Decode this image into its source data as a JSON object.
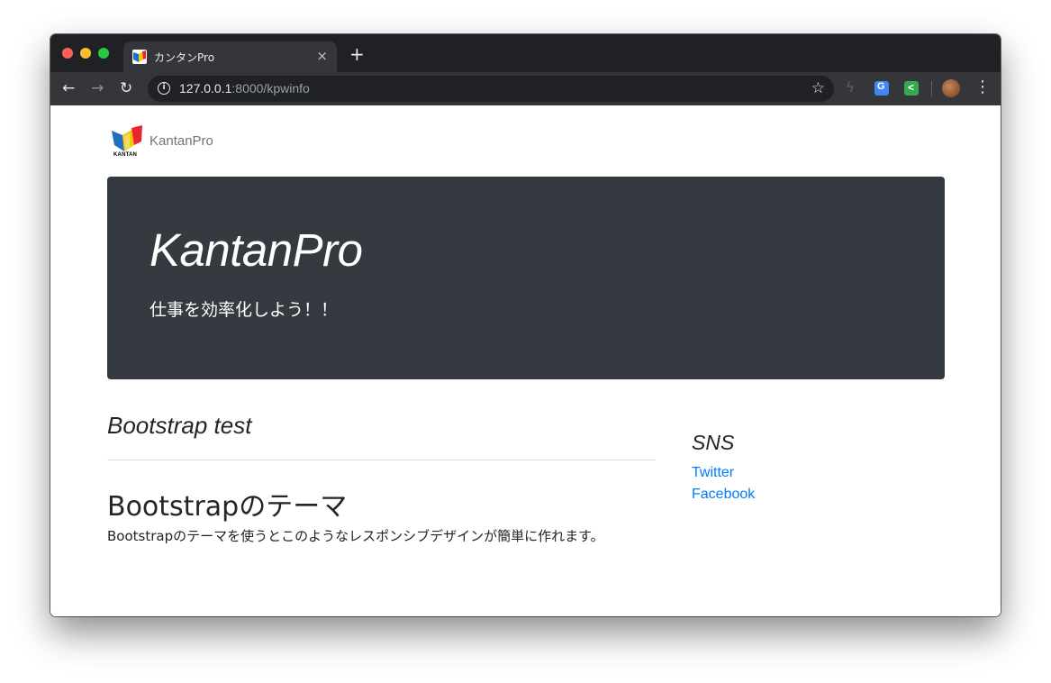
{
  "browser": {
    "tab": {
      "title": "カンタンPro",
      "close_glyph": "×"
    },
    "new_tab_glyph": "+",
    "nav": {
      "back": "←",
      "forward": "→",
      "reload": "↻"
    },
    "address": {
      "host": "127.0.0.1",
      "path": ":8000/kpwinfo"
    },
    "star_glyph": "☆",
    "menu_glyph": "⋮"
  },
  "brand": {
    "name": "KantanPro",
    "logo_text": "KANTAN"
  },
  "jumbotron": {
    "title": "KantanPro",
    "lead": "仕事を効率化しよう！！"
  },
  "main": {
    "section_title": "Bootstrap test",
    "post_title": "Bootstrapのテーマ",
    "post_body": "Bootstrapのテーマを使うとこのようなレスポンシブデザインが簡単に作れます。"
  },
  "sidebar": {
    "title": "SNS",
    "links": [
      {
        "label": "Twitter"
      },
      {
        "label": "Facebook"
      }
    ]
  },
  "colors": {
    "jumbotron_bg": "#343a40",
    "link": "#007bff",
    "chrome_dark": "#202124",
    "chrome_toolbar": "#35363a"
  }
}
